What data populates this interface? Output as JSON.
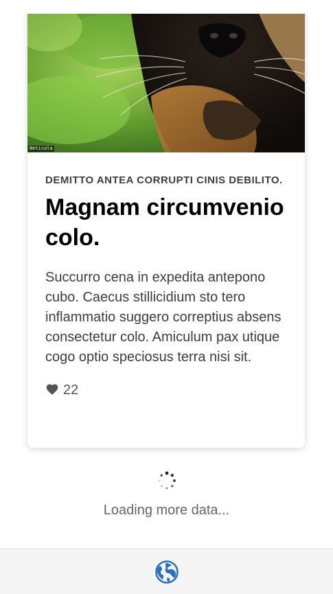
{
  "card": {
    "image": {
      "alt": "cat-photo",
      "watermark": "Neticola"
    },
    "eyebrow": "DEMITTO ANTEA CORRUPTI CINIS DEBILITO.",
    "title": "Magnam circumvenio colo.",
    "description": "Succurro cena in expedita antepono cubo. Caecus stillicidium sto tero inflammatio suggero correptius absens consectetur colo. Amiculum pax utique cogo optio speciosus terra nisi sit.",
    "likes": {
      "icon": "heart-icon",
      "count": "22"
    }
  },
  "loader": {
    "icon": "spinner-icon",
    "text": "Loading more data..."
  },
  "bottom_nav": {
    "icon": "globe-icon"
  },
  "colors": {
    "accent": "#2f6fbf",
    "text": "#000000",
    "muted": "#666666"
  }
}
